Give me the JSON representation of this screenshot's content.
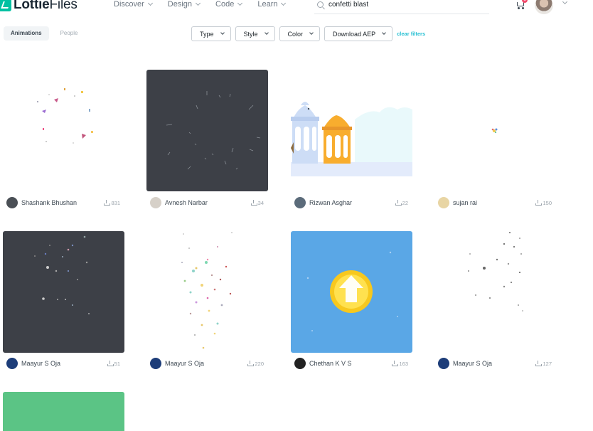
{
  "header": {
    "logo_bold": "Lottie",
    "logo_light": "Files",
    "nav": [
      {
        "label": "Discover"
      },
      {
        "label": "Design"
      },
      {
        "label": "Code"
      },
      {
        "label": "Learn"
      }
    ],
    "search_value": "confetti blast",
    "cart_count": "1"
  },
  "tabs": [
    {
      "label": "Animations",
      "active": true
    },
    {
      "label": "People",
      "active": false
    }
  ],
  "filters": {
    "type": "Type",
    "style": "Style",
    "color": "Color",
    "download": "Download AEP",
    "clear": "clear filters"
  },
  "cards": [
    {
      "author": "Shashank Bhushan",
      "downloads": "831"
    },
    {
      "author": "Avnesh Narbar",
      "downloads": "34"
    },
    {
      "author": "Rizwan Asghar",
      "downloads": "22"
    },
    {
      "author": "sujan rai",
      "downloads": "150"
    },
    {
      "author": "Maayur S Oja",
      "downloads": "51"
    },
    {
      "author": "Maayur S Oja",
      "downloads": "220"
    },
    {
      "author": "Chethan K V S",
      "downloads": "163"
    },
    {
      "author": "Maayur S Oja",
      "downloads": "127"
    }
  ],
  "colors": {
    "accent": "#00c1a2",
    "link": "#27c0d3",
    "dark_thumb": "#3d4047",
    "blue_thumb": "#5aa7e6",
    "green_thumb": "#5bc485",
    "badge": "#f14a6b"
  }
}
